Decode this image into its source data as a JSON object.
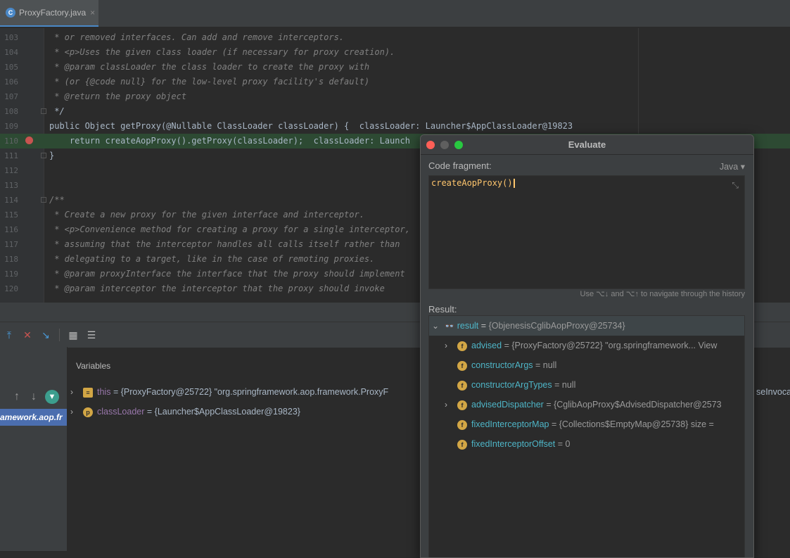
{
  "tab": {
    "icon": "class-icon",
    "filename": "ProxyFactory.java",
    "close": "×"
  },
  "editor": {
    "lines": [
      {
        "num": "103",
        "text": " * or removed interfaces. Can add and remove interceptors."
      },
      {
        "num": "104",
        "text": " * <p>Uses the given class loader (if necessary for proxy creation)."
      },
      {
        "num": "105",
        "text": " * @param classLoader the class loader to create the proxy with"
      },
      {
        "num": "106",
        "text": " * (or {@code null} for the low-level proxy facility's default)"
      },
      {
        "num": "107",
        "text": " * @return the proxy object"
      },
      {
        "num": "108",
        "text": " */"
      },
      {
        "num": "109",
        "text": "public Object getProxy(@Nullable ClassLoader classLoader) {  classLoader: Launcher$AppClassLoader@19823"
      },
      {
        "num": "110",
        "text": "    return createAopProxy().getProxy(classLoader);  classLoader: Launch"
      },
      {
        "num": "111",
        "text": "}"
      },
      {
        "num": "112",
        "text": ""
      },
      {
        "num": "113",
        "text": ""
      },
      {
        "num": "114",
        "text": "/**"
      },
      {
        "num": "115",
        "text": " * Create a new proxy for the given interface and interceptor."
      },
      {
        "num": "116",
        "text": " * <p>Convenience method for creating a proxy for a single interceptor,"
      },
      {
        "num": "117",
        "text": " * assuming that the interceptor handles all calls itself rather than"
      },
      {
        "num": "118",
        "text": " * delegating to a target, like in the case of remoting proxies."
      },
      {
        "num": "119",
        "text": " * @param proxyInterface the interface that the proxy should implement"
      },
      {
        "num": "120",
        "text": " * @param interceptor the interceptor that the proxy should invoke"
      }
    ]
  },
  "debug": {
    "variables_title": "Variables",
    "frame_selected": "amework.aop.fr",
    "overflow_text": "seInvoca",
    "variables": [
      {
        "badge": "≡",
        "name": "this",
        "value": "= {ProxyFactory@25722} \"org.springframework.aop.framework.ProxyF"
      },
      {
        "badge": "p",
        "name": "classLoader",
        "value": "= {Launcher$AppClassLoader@19823}"
      }
    ]
  },
  "dialog": {
    "title": "Evaluate",
    "code_fragment_label": "Code fragment:",
    "language": "Java",
    "code": "createAopProxy()",
    "history_hint": "Use ⌥↓ and ⌥↑ to navigate through the history",
    "result_label": "Result:",
    "result_root": {
      "name": "result",
      "value": "{ObjenesisCglibAopProxy@25734}"
    },
    "result_fields": [
      {
        "name": "advised",
        "value": "= {ProxyFactory@25722} \"org.springframework... View",
        "expandable": true
      },
      {
        "name": "constructorArgs",
        "value": "= null",
        "expandable": false
      },
      {
        "name": "constructorArgTypes",
        "value": "= null",
        "expandable": false
      },
      {
        "name": "advisedDispatcher",
        "value": "= {CglibAopProxy$AdvisedDispatcher@2573",
        "expandable": true
      },
      {
        "name": "fixedInterceptorMap",
        "value": "= {Collections$EmptyMap@25738}  size =",
        "expandable": false
      },
      {
        "name": "fixedInterceptorOffset",
        "value": "= 0",
        "expandable": false
      }
    ]
  },
  "colors": {
    "accent": "#4a88c7",
    "exec_line": "#2d4a33",
    "breakpoint": "#c75450",
    "field_name": "#4eb5c7"
  }
}
